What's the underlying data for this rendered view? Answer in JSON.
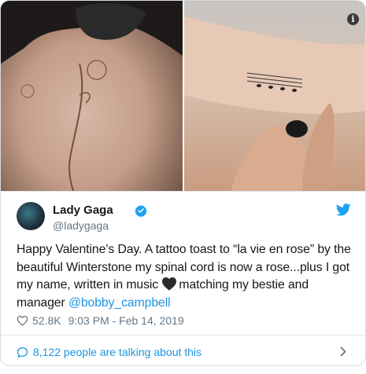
{
  "media": {
    "left_photo_icon": "image-placeholder",
    "right_photo_icon": "image-placeholder",
    "info_icon": "info-icon"
  },
  "author": {
    "name": "Lady Gaga",
    "handle": "@ladygaga",
    "verified": true,
    "avatar_icon": "avatar"
  },
  "tweet": {
    "text_part1": "Happy Valentine’s Day. A tattoo toast to “la vie en rose” by the beautiful Winterstone my spinal cord is now a rose...plus I got my name, written in music ",
    "emoji": "black-heart-emoji",
    "text_part2": "matching my bestie and manager ",
    "mention": "@bobby_campbell"
  },
  "meta": {
    "likes": "52.8K",
    "timestamp": "9:03 PM - Feb 14, 2019"
  },
  "footer": {
    "talking": "8,122 people are talking about this"
  },
  "colors": {
    "link": "#1b95e0",
    "secondary_text": "#657786",
    "primary_text": "#14171a",
    "border": "#e1e8ed"
  }
}
